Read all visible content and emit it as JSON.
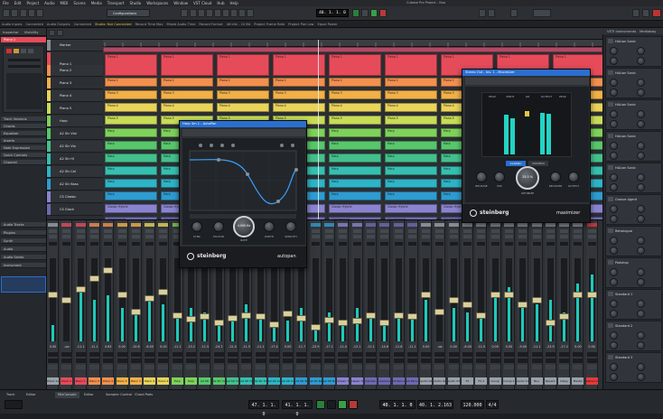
{
  "menubar": {
    "items": [
      "File",
      "Edit",
      "Project",
      "Audio",
      "MIDI",
      "Scores",
      "Media",
      "Transport",
      "Studio",
      "Workspaces",
      "Window",
      "VST Cloud",
      "Hub",
      "Help"
    ],
    "window_title": "Cubase Pro Project - Nuo"
  },
  "toolbar": {
    "config_label": "Configurations",
    "time_display": "40. 1. 1. 0",
    "tempo": "120.000"
  },
  "status": [
    "Audio Inputs",
    "Connected",
    "Audio Outputs",
    "Connected",
    "Studio: Not Connected",
    "Record Time Max",
    "Mixed Audio Time",
    "Record Format",
    "48 kHz - 24 Bit",
    "Project Frame Rate",
    "Project Pan Law",
    "Equal Power"
  ],
  "leftzone": {
    "tabs": [
      "Inspector",
      "Visibility"
    ],
    "track_name": "Piano 1",
    "sections": [
      "Track Versions",
      "Chords",
      "Equalizer",
      "Inserts",
      "Note Expression",
      "Quick Controls",
      "Channel"
    ],
    "bottom_sections": [
      "Audio Tracks",
      "Plugins",
      "Synth",
      "Audio",
      "Audio Sends",
      "Instrument"
    ]
  },
  "tracks": [
    {
      "name": "Marker",
      "color": "#8a8e94"
    },
    {
      "name": "Piano 1",
      "color": "#e64b5a"
    },
    {
      "name": "Piano 2",
      "color": "#f2904e"
    },
    {
      "name": "Piano 3",
      "color": "#f2b048"
    },
    {
      "name": "Piano 4",
      "color": "#e9d35a"
    },
    {
      "name": "Piano 5",
      "color": "#c8dc58"
    },
    {
      "name": "Harp",
      "color": "#7ed25a"
    },
    {
      "name": "A2 Str Viol",
      "color": "#58c76c"
    },
    {
      "name": "A2 Str Vio",
      "color": "#44c08d"
    },
    {
      "name": "A2 Str Hi",
      "color": "#36bfb0"
    },
    {
      "name": "A2 Str Cel",
      "color": "#2fb3c7"
    },
    {
      "name": "A2 Str Bass",
      "color": "#2f9bd0"
    },
    {
      "name": "CS Classic",
      "color": "#8a84d0"
    },
    {
      "name": "CS Glock",
      "color": "#6e6ab2"
    }
  ],
  "event_labels": [
    "Piano 1",
    "Piano 2",
    "Piano 3",
    "Piano 4",
    "Piano 5",
    "Harp",
    "Classic Hybrid",
    "Glockenspiel"
  ],
  "mixer": {
    "strips": [
      {
        "name": "Piano 1s",
        "color": "#9aa1a8",
        "val": "0.00",
        "meter": 0.2,
        "fader": 0.56
      },
      {
        "name": "Piano 1",
        "color": "#e64b5a",
        "val": "-oo",
        "meter": 0.0,
        "fader": 0.5
      },
      {
        "name": "Piano 1",
        "color": "#e64b5a",
        "val": "-11.1",
        "meter": 0.6,
        "fader": 0.64
      },
      {
        "name": "Piano 2",
        "color": "#f2904e",
        "val": "-11.1",
        "meter": 0.5,
        "fader": 0.78
      },
      {
        "name": "Piano 2",
        "color": "#f2904e",
        "val": "4.63",
        "meter": 0.55,
        "fader": 0.88
      },
      {
        "name": "Piano 3",
        "color": "#f2b048",
        "val": "0.00",
        "meter": 0.4,
        "fader": 0.56
      },
      {
        "name": "Piano 3",
        "color": "#f2b048",
        "val": "-10.6",
        "meter": 0.35,
        "fader": 0.34
      },
      {
        "name": "Piano 4",
        "color": "#e9d35a",
        "val": "-6.00",
        "meter": 0.5,
        "fader": 0.52
      },
      {
        "name": "Piano 4",
        "color": "#e9d35a",
        "val": "0.00",
        "meter": 0.45,
        "fader": 0.6
      },
      {
        "name": "Harp",
        "color": "#7ed25a",
        "val": "-11.1",
        "meter": 0.3,
        "fader": 0.3
      },
      {
        "name": "Harp",
        "color": "#7ed25a",
        "val": "-13.2",
        "meter": 0.4,
        "fader": 0.25
      },
      {
        "name": "A2 Str",
        "color": "#58c76c",
        "val": "-11.5",
        "meter": 0.35,
        "fader": 0.28
      },
      {
        "name": "A2 Str Viol",
        "color": "#58c76c",
        "val": "-24.2",
        "meter": 0.2,
        "fader": 0.2
      },
      {
        "name": "A2 Str Vio",
        "color": "#44c08d",
        "val": "-12.4",
        "meter": 0.3,
        "fader": 0.26
      },
      {
        "name": "A2 Str Hi",
        "color": "#36bfb0",
        "val": "-11.5",
        "meter": 0.45,
        "fader": 0.3
      },
      {
        "name": "A2 Str Hi",
        "color": "#36bfb0",
        "val": "-11.1",
        "meter": 0.3,
        "fader": 0.28
      },
      {
        "name": "A2 Str Cel",
        "color": "#2fb3c7",
        "val": "-17.4",
        "meter": 0.2,
        "fader": 0.18
      },
      {
        "name": "A2 Str Cel",
        "color": "#2fb3c7",
        "val": "0.00",
        "meter": 0.25,
        "fader": 0.32
      },
      {
        "name": "A2 Str Bass",
        "color": "#2f9bd0",
        "val": "-11.7",
        "meter": 0.4,
        "fader": 0.26
      },
      {
        "name": "A2 Str Bass",
        "color": "#2f9bd0",
        "val": "-23.9",
        "meter": 0.2,
        "fader": 0.14
      },
      {
        "name": "A2 Str Bass",
        "color": "#2f9bd0",
        "val": "-17.1",
        "meter": 0.35,
        "fader": 0.24
      },
      {
        "name": "Classic Hybrid",
        "color": "#8a84d0",
        "val": "-11.0",
        "meter": 0.25,
        "fader": 0.2
      },
      {
        "name": "Classic Hybrid",
        "color": "#8a84d0",
        "val": "-12.1",
        "meter": 0.4,
        "fader": 0.22
      },
      {
        "name": "Glocken",
        "color": "#6e6ab2",
        "val": "-11.1",
        "meter": 0.3,
        "fader": 0.3
      },
      {
        "name": "Glocken",
        "color": "#6e6ab2",
        "val": "-14.6",
        "meter": 0.25,
        "fader": 0.2
      },
      {
        "name": "CS Percussion",
        "color": "#6e6ab2",
        "val": "-11.6",
        "meter": 0.35,
        "fader": 0.3
      },
      {
        "name": "CS Percussion",
        "color": "#6e6ab2",
        "val": "-11.1",
        "meter": 0.3,
        "fader": 0.28
      },
      {
        "name": "Audio 01",
        "color": "#9aa1a8",
        "val": "0.00",
        "meter": 0.5,
        "fader": 0.56
      },
      {
        "name": "Audio 02",
        "color": "#9aa1a8",
        "val": "-oo",
        "meter": 0.0,
        "fader": 0.34
      },
      {
        "name": "Audio 03",
        "color": "#9aa1a8",
        "val": "0.00",
        "meter": 0.4,
        "fader": 0.5
      },
      {
        "name": "FX",
        "color": "#9aa1a8",
        "val": "-6.00",
        "meter": 0.35,
        "fader": 0.44
      },
      {
        "name": "FX 2",
        "color": "#9aa1a8",
        "val": "-11.5",
        "meter": 0.3,
        "fader": 0.3
      },
      {
        "name": "Group",
        "color": "#9aa1a8",
        "val": "0.00",
        "meter": 0.6,
        "fader": 0.56
      },
      {
        "name": "Group 2",
        "color": "#9aa1a8",
        "val": "0.00",
        "meter": 0.65,
        "fader": 0.56
      },
      {
        "name": "Audio 11",
        "color": "#9aa1a8",
        "val": "-9.00",
        "meter": 0.4,
        "fader": 0.44
      },
      {
        "name": "Bus",
        "color": "#9aa1a8",
        "val": "-11.1",
        "meter": 0.45,
        "fader": 0.5
      },
      {
        "name": "Reverb",
        "color": "#9aa1a8",
        "val": "-23.9",
        "meter": 0.5,
        "fader": 0.2
      },
      {
        "name": "Delay",
        "color": "#9aa1a8",
        "val": "-17.2",
        "meter": 0.35,
        "fader": 0.28
      },
      {
        "name": "Master",
        "color": "#9aa1a8",
        "val": "0.00",
        "meter": 0.7,
        "fader": 0.56
      },
      {
        "name": "Stereo Out",
        "color": "#e63a3a",
        "val": "0.00",
        "meter": 0.8,
        "fader": 0.56
      }
    ]
  },
  "rightzone": {
    "tabs": [
      "VSTi Instruments",
      "Mediabay"
    ],
    "slots": [
      "HALion Sonic",
      "HALion Sonic",
      "HALion Sonic",
      "HALion Sonic",
      "HALion Sonic",
      "Groove Agent",
      "Retrologue",
      "Padshop",
      "Standard 1",
      "Standard 2",
      "Standard 3"
    ]
  },
  "autopan": {
    "title": "Harp 3m 1 - AutoPan",
    "brand": "steinberg",
    "product": "autopan",
    "knob_labels": [
      "SYNC",
      "FACTOR",
      "RATE",
      "WIDTH",
      "SMOOTH"
    ],
    "rate_value": "4.000 Hz"
  },
  "maximizer": {
    "title": "Stereo Out - Ins. 1 - Maximizer",
    "brand": "steinberg",
    "product": "maximizer",
    "labels": [
      "PEAK",
      "INPUT",
      "GR",
      "OUTPUT",
      "PEAK"
    ],
    "mode": "CLASSIC",
    "mode2": "MODERN",
    "optimize_value": "25.0 %",
    "knob_labels": [
      "RELEASE",
      "MIX",
      "OPTIMIZE",
      "RECOVER",
      "OUTPUT"
    ]
  },
  "bottombar": {
    "tabs": [
      "Track",
      "Editor",
      "MixConsole",
      "Editor",
      "Sampler Control",
      "Chord Pads"
    ],
    "time_primary": "40. 1. 1. 0",
    "time_secondary": "40. 1. 2.163",
    "tempo": "120.000",
    "signature": "4/4",
    "left_locator": "47. 1. 1. 0",
    "right_locator": "41. 1. 1. 0"
  },
  "accent": "#2a6fd0"
}
